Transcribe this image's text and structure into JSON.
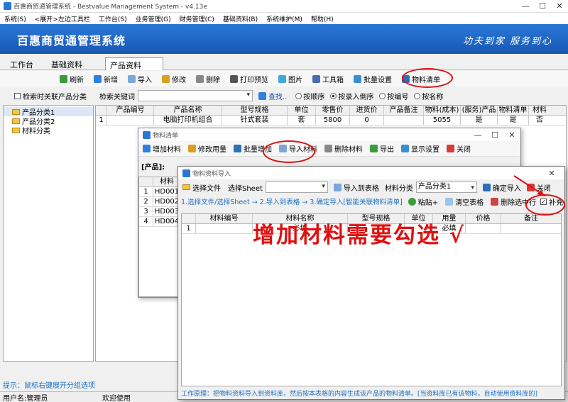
{
  "window": {
    "title": "百惠商贸通管理系统 - Bestvalue Management System - v4.13e"
  },
  "menu": [
    "系统(S)",
    "<展开>左边工具栏",
    "工作台(S)",
    "业务管理(G)",
    "财务管理(C)",
    "基础资料(B)",
    "系统维护(M)",
    "帮助(H)"
  ],
  "banner": {
    "title": "百惠商贸通管理系统",
    "slogan": "功夫到家 服务到心"
  },
  "tabs": [
    {
      "label": "工作台"
    },
    {
      "label": "基础资料"
    },
    {
      "label": "产品资料",
      "close": "×"
    }
  ],
  "toolbar": [
    "刷新",
    "新增",
    "导入",
    "修改",
    "删除",
    "打印预览",
    "图片",
    "工具箱",
    "批量设置",
    "物料清单"
  ],
  "search": {
    "related_label": "检索时关联产品分类",
    "keyword_label": "检索关键词",
    "find_label": "查找..",
    "radios": [
      {
        "label": "按顺序",
        "on": false
      },
      {
        "label": "按录入倒序",
        "on": true
      },
      {
        "label": "按编号",
        "on": false
      },
      {
        "label": "按名称",
        "on": false
      }
    ]
  },
  "tree": [
    "产品分类1",
    "产品分类2",
    "材料分类"
  ],
  "grid": {
    "headers": [
      "",
      "产品编号",
      "产品名称",
      "型号规格",
      "单位",
      "零售价",
      "进货价",
      "产品备注",
      "物料(成本)",
      "(服务)产品",
      "物料清单",
      "材料"
    ],
    "rows": [
      [
        "1",
        "",
        "电脑打印机组合",
        "针式套装",
        "套",
        "5800",
        "0",
        "",
        "5055",
        "是",
        "是",
        "否"
      ]
    ]
  },
  "hint": "提示：鼠标右键展开分组选项",
  "status": {
    "user": "用户名:管理员",
    "welcome": "欢迎使用"
  },
  "dlg1": {
    "title": "物料清单",
    "toolbar": [
      "增加材料",
      "修改用量",
      "批量增加",
      "导入材料",
      "删除材料",
      "导出",
      "显示设置",
      "关闭"
    ],
    "product_label": "[产品]:",
    "col": "材料",
    "rows": [
      [
        "1",
        "HD001"
      ],
      [
        "2",
        "HD002"
      ],
      [
        "3",
        "HD003"
      ],
      [
        "4",
        "HD004"
      ]
    ]
  },
  "dlg2": {
    "title": "物料资料导入",
    "select_file": "选择文件",
    "select_sheet": "选择Sheet",
    "import_to_table": "导入到表格",
    "category_label": "材料分类",
    "category_value": "产品分类1",
    "confirm_import": "确定导入",
    "close": "关闭",
    "steps": "1.选择文件/选择Sheet → 2.导入到表格 → 3.确定导入[智能关联物料清单]",
    "paste": "粘贴+",
    "clear_table": "清空表格",
    "delete_selected": "删除选中行",
    "supplement": "补充",
    "headers": [
      "",
      "材料编号",
      "材料名称",
      "型号规格",
      "单位",
      "用量",
      "价格",
      "备注"
    ],
    "row1": [
      "1",
      "",
      "必填",
      "",
      "",
      "必填",
      "",
      ""
    ],
    "footer": "工作原理：把物料资料导入到资料库，然后按本表格的内容生成该产品的物料清单。[当资料库已有该物料，自动使用资料库的]"
  },
  "annotation": "增加材料需要勾选 √",
  "colors": {
    "banner": "#1f68c6",
    "accent_red": "#e01010",
    "link_blue": "#1a6fc4"
  }
}
